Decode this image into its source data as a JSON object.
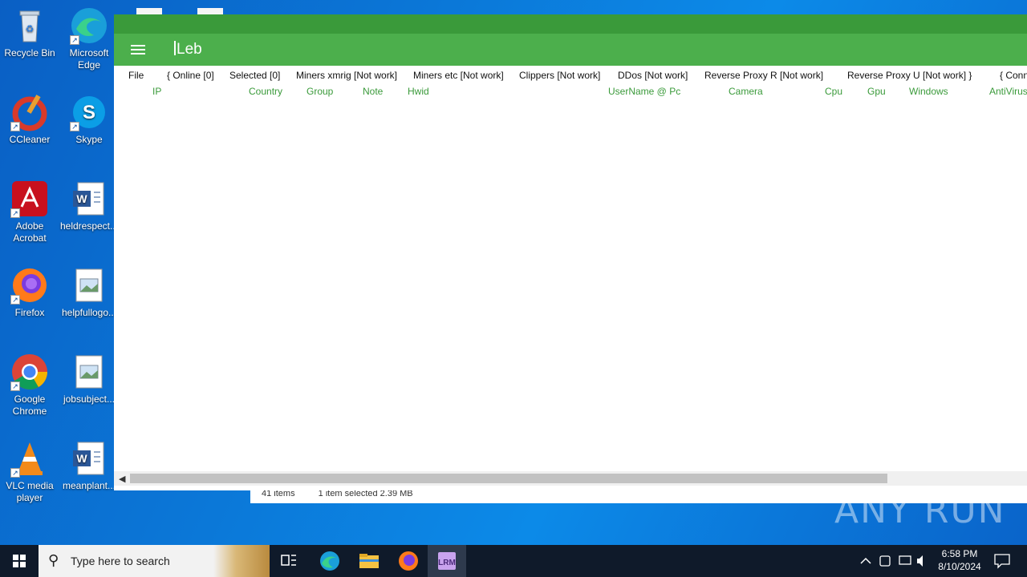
{
  "desktop": {
    "icons": [
      {
        "label": "Recycle Bin"
      },
      {
        "label": "Microsoft Edge"
      },
      {
        "label": "CCleaner"
      },
      {
        "label": "Skype"
      },
      {
        "label": "Adobe Acrobat"
      },
      {
        "label": "heldrespect..."
      },
      {
        "label": "Firefox"
      },
      {
        "label": "helpfullogo..."
      },
      {
        "label": "Google Chrome"
      },
      {
        "label": "jobsubject..."
      },
      {
        "label": "VLC media player"
      },
      {
        "label": "meanplant..."
      }
    ]
  },
  "explorer_status": {
    "items": "41 items",
    "selected": "1 item selected  2.39 MB"
  },
  "app": {
    "title": "Leb",
    "menu": [
      "File",
      "{ Online [0]",
      "Selected [0]",
      "Miners xmrig [Not work]",
      "Miners etc [Not work]",
      "Clippers [Not work]",
      "DDos [Not work]",
      "Reverse Proxy R [Not work]",
      "Reverse Proxy U [Not work] }",
      "{ Conn"
    ],
    "columns": [
      "IP",
      "Country",
      "Group",
      "Note",
      "Hwid",
      "UserName @ Pc",
      "Camera",
      "Cpu",
      "Gpu",
      "Windows",
      "AntiVirus"
    ],
    "colors": {
      "header": "#4caf4c",
      "topbar": "#3a9a3a",
      "column_text": "#3a9a3a"
    }
  },
  "watermark": "ANY RUN",
  "taskbar": {
    "search_placeholder": "Type here to search",
    "time": "6:58 PM",
    "date": "8/10/2024"
  }
}
